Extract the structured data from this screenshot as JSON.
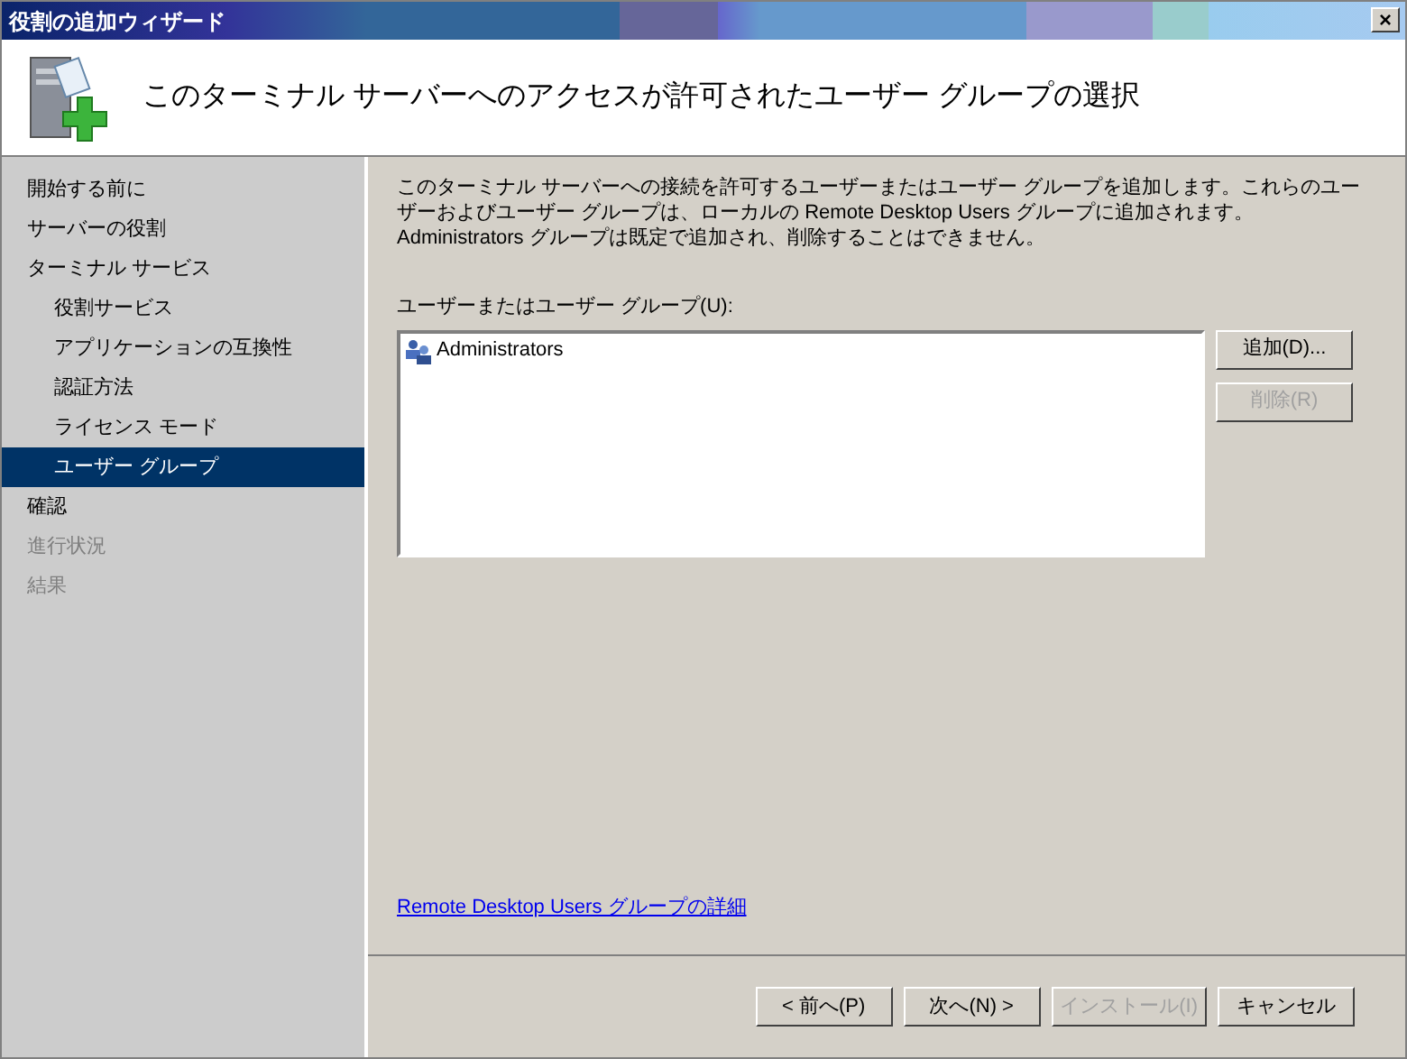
{
  "window": {
    "title": "役割の追加ウィザード",
    "close": "×"
  },
  "header": {
    "title": "このターミナル サーバーへのアクセスが許可されたユーザー グループの選択"
  },
  "sidebar": {
    "items": [
      {
        "label": "開始する前に",
        "selected": false,
        "disabled": false
      },
      {
        "label": "サーバーの役割",
        "selected": false,
        "disabled": false
      },
      {
        "label": "ターミナル サービス",
        "selected": false,
        "disabled": false,
        "children": [
          {
            "label": "役割サービス",
            "selected": false,
            "disabled": false
          },
          {
            "label": "アプリケーションの互換性",
            "selected": false,
            "disabled": false
          },
          {
            "label": "認証方法",
            "selected": false,
            "disabled": false
          },
          {
            "label": "ライセンス モード",
            "selected": false,
            "disabled": false
          },
          {
            "label": "ユーザー グループ",
            "selected": true,
            "disabled": false
          }
        ]
      },
      {
        "label": "確認",
        "selected": false,
        "disabled": false
      },
      {
        "label": "進行状況",
        "selected": false,
        "disabled": true
      },
      {
        "label": "結果",
        "selected": false,
        "disabled": true
      }
    ]
  },
  "content": {
    "description": "このターミナル サーバーへの接続を許可するユーザーまたはユーザー グループを追加します。これらのユーザーおよびユーザー グループは、ローカルの Remote Desktop Users グループに追加されます。Administrators グループは既定で追加され、削除することはできません。",
    "list_label": "ユーザーまたはユーザー グループ(U):",
    "list_items": [
      "Administrators"
    ],
    "side_buttons": [
      {
        "label": "追加(D)...",
        "disabled": false
      },
      {
        "label": "削除(R)",
        "disabled": true
      }
    ],
    "link": "Remote Desktop Users グループの詳細"
  },
  "footer": {
    "buttons": [
      {
        "label": "< 前へ(P)",
        "disabled": false
      },
      {
        "label": "次へ(N) >",
        "disabled": false
      },
      {
        "label": "インストール(I)",
        "disabled": true
      },
      {
        "label": "キャンセル",
        "disabled": false
      }
    ]
  }
}
